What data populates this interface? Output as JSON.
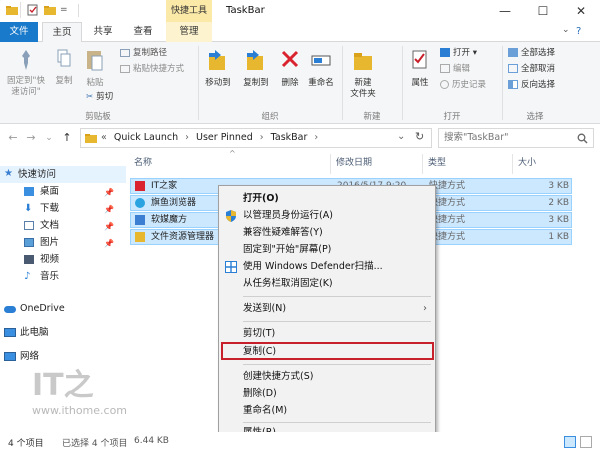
{
  "window": {
    "title": "TaskBar",
    "contextual_tab_group": "快捷工具",
    "controls": {
      "minimize": "—",
      "maximize": "☐",
      "close": "✕"
    }
  },
  "tabs": [
    {
      "label": "文件"
    },
    {
      "label": "主页"
    },
    {
      "label": "共享"
    },
    {
      "label": "查看"
    },
    {
      "label": "管理"
    }
  ],
  "ribbon": {
    "clipboard": {
      "pin": "固定到\"快\n速访问\"",
      "copy": "复制",
      "paste": "粘贴",
      "copy_path": "复制路径",
      "paste_shortcut": "粘贴快捷方式",
      "cut": "剪切",
      "label": "剪贴板"
    },
    "organize": {
      "move_to": "移动到",
      "copy_to": "复制到",
      "delete": "删除",
      "rename": "重命名",
      "label": "组织"
    },
    "new": {
      "new_folder": "新建\n文件夹",
      "label": "新建"
    },
    "open": {
      "properties": "属性",
      "open": "打开 ▾",
      "edit": "编辑",
      "history": "历史记录",
      "label": "打开"
    },
    "select": {
      "select_all": "全部选择",
      "select_none": "全部取消",
      "invert": "反向选择",
      "label": "选择"
    }
  },
  "address": {
    "segments": [
      "«",
      "Quick Launch",
      "›",
      "User Pinned",
      "›",
      "TaskBar",
      "›"
    ],
    "search_placeholder": "搜索\"TaskBar\"",
    "refresh": "↻",
    "dropdown": "⌄"
  },
  "nav": {
    "back": "←",
    "forward": "→",
    "recent": "⌄",
    "up": "↑",
    "items": [
      {
        "label": "快速访问"
      },
      {
        "label": "桌面"
      },
      {
        "label": "下载"
      },
      {
        "label": "文档"
      },
      {
        "label": "图片"
      },
      {
        "label": "视频"
      },
      {
        "label": "音乐"
      },
      {
        "label": "OneDrive"
      },
      {
        "label": "此电脑"
      },
      {
        "label": "网络"
      }
    ]
  },
  "list": {
    "columns": {
      "name": "名称",
      "modified": "修改日期",
      "type": "类型",
      "size": "大小"
    },
    "rows": [
      {
        "name": "IT之家",
        "modified": "2016/5/17 9:20",
        "type": "快捷方式",
        "size": "3 KB",
        "icon_color": "#d9232e"
      },
      {
        "name": "旗鱼浏览器",
        "modified": "",
        "type": "快捷方式",
        "size": "2 KB",
        "icon_color": "#2aa3e0"
      },
      {
        "name": "软媒魔方",
        "modified": "",
        "type": "快捷方式",
        "size": "3 KB",
        "icon_color": "#3a7fd1"
      },
      {
        "name": "文件资源管理器",
        "modified": "",
        "type": "快捷方式",
        "size": "1 KB",
        "icon_color": "#e8b730"
      }
    ]
  },
  "context_menu": {
    "items": [
      "打开(O)",
      "以管理员身份运行(A)",
      "兼容性疑难解答(Y)",
      "固定到\"开始\"屏幕(P)",
      "使用 Windows Defender扫描...",
      "从任务栏取消固定(K)",
      "发送到(N)",
      "剪切(T)",
      "复制(C)",
      "创建快捷方式(S)",
      "删除(D)",
      "重命名(M)",
      "属性(R)"
    ],
    "highlight_color": "#c8202a"
  },
  "status": {
    "count": "4 个项目",
    "selected": "已选择 4 个项目",
    "size": "6.44 KB"
  },
  "watermark": {
    "logo": "IT之",
    "url": "www.ithome.com"
  }
}
